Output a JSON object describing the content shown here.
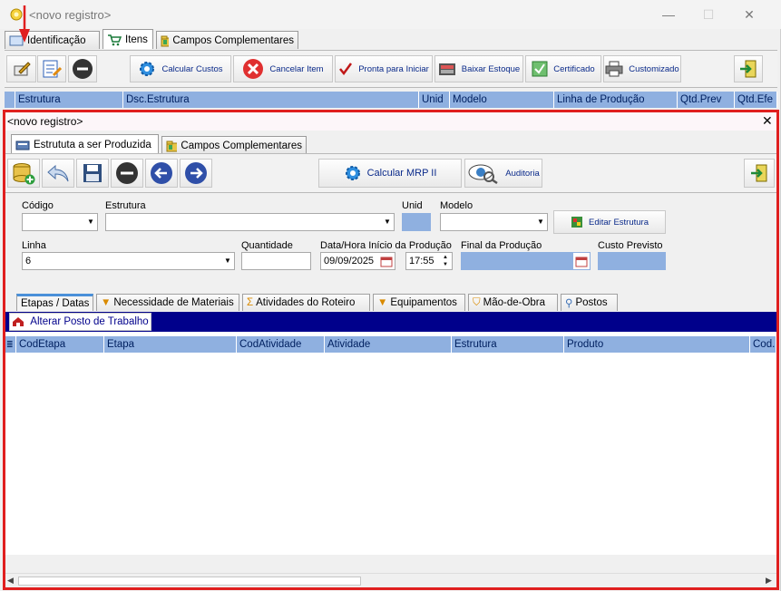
{
  "outer": {
    "title": "<novo registro>",
    "window_buttons": {
      "minimize": "—",
      "maximize": "☐",
      "close": "✕"
    },
    "tabs": [
      {
        "label": "Identificação"
      },
      {
        "label": "Itens"
      },
      {
        "label": "Campos Complementares"
      }
    ],
    "toolbar": {
      "calcular_custos": "Calcular Custos",
      "cancelar_item": "Cancelar Item",
      "pronta_para_iniciar": "Pronta para Iniciar",
      "baixar_estoque": "Baixar Estoque",
      "certificado": "Certificado",
      "customizado": "Customizado"
    },
    "grid_columns": [
      "Estrutura",
      "Dsc.Estrutura",
      "Unid",
      "Modelo",
      "Linha de Produção",
      "Qtd.Prev",
      "Qtd.Efe"
    ]
  },
  "inner": {
    "title": "<novo registro>",
    "close": "✕",
    "tabs": [
      {
        "label": "Estrututa a ser Produzida"
      },
      {
        "label": "Campos Complementares"
      }
    ],
    "toolbar": {
      "calcular_mrp": "Calcular MRP II",
      "auditoria": "Auditoria"
    },
    "form": {
      "codigo_label": "Código",
      "codigo_value": "",
      "estrutura_label": "Estrutura",
      "estrutura_value": "",
      "unid_label": "Unid",
      "modelo_label": "Modelo",
      "modelo_value": "",
      "editar_estrutura": "Editar Estrutura",
      "linha_label": "Linha",
      "linha_value": "6",
      "quantidade_label": "Quantidade",
      "quantidade_value": "",
      "data_inicio_label": "Data/Hora Início da Produção",
      "data_inicio_value": "09/09/2025",
      "hora_inicio_value": "17:55",
      "final_label": "Final da Produção",
      "custo_label": "Custo Previsto"
    },
    "detail_tabs": [
      {
        "label": "Etapas / Datas"
      },
      {
        "label": "Necessidade de Materiais"
      },
      {
        "label": "Atividades do Roteiro"
      },
      {
        "label": "Equipamentos"
      },
      {
        "label": "Mão-de-Obra"
      },
      {
        "label": "Postos"
      }
    ],
    "alterar_posto": "Alterar Posto de Trabalho",
    "grid_columns": [
      "CodEtapa",
      "Etapa",
      "CodAtividade",
      "Atividade",
      "Estrutura",
      "Produto",
      "Cod.E"
    ]
  },
  "colors": {
    "accent_blue": "#8fb0e0",
    "navy": "#00008b",
    "highlight_red": "#e01f1f",
    "arrow_red": "#e01f1f"
  }
}
